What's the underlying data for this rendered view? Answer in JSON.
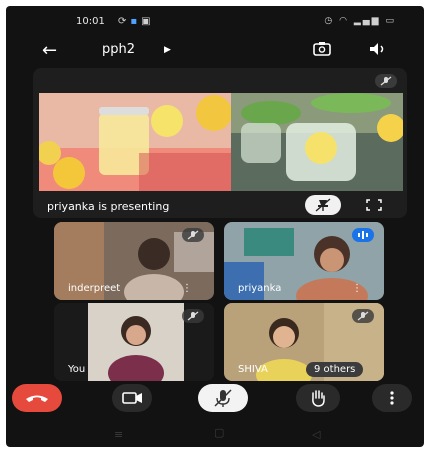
{
  "status_bar": {
    "time": "10:01",
    "left_icons": [
      "sync-icon",
      "app-icon",
      "notification-icon"
    ],
    "right_icons": [
      "alarm-icon",
      "wifi-icon",
      "signal-icon",
      "battery-icon"
    ]
  },
  "header": {
    "title": "pph2",
    "back_icon": "arrow-left-icon",
    "switch_camera_icon": "camera-switch-icon",
    "audio_icon": "speaker-icon"
  },
  "presentation": {
    "label": "priyanka is presenting",
    "mute_icon": "mic-off-icon",
    "pin_icon": "pin-off-icon",
    "fullscreen_icon": "fullscreen-icon"
  },
  "participants": [
    {
      "name": "inderpreet",
      "mic_icon": "mic-off-icon",
      "more_icon": "kebab-icon"
    },
    {
      "name": "priyanka",
      "mic_icon": "speaking-icon",
      "more_icon": "kebab-icon"
    },
    {
      "name": "You",
      "mic_icon": "mic-off-icon",
      "more_icon": ""
    },
    {
      "name": "SHIVA",
      "mic_icon": "mic-off-icon",
      "more_icon": "",
      "others_badge": "9 others"
    }
  ],
  "controls": {
    "end_call_icon": "end-call-icon",
    "video_icon": "video-icon",
    "mute_icon": "mic-off-icon",
    "raise_hand_icon": "hand-icon",
    "more_icon": "more-vertical-icon"
  },
  "colors": {
    "end_call": "#e64a3c",
    "background": "#121212",
    "speaking_badge": "#1a73e8"
  }
}
